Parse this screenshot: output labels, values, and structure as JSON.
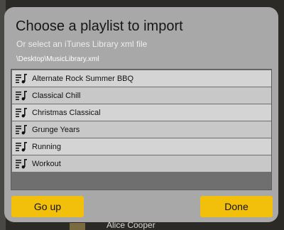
{
  "background": {
    "now_playing_artist": "Alice Cooper"
  },
  "dialog": {
    "title": "Choose a playlist to import",
    "subtitle": "Or select an iTunes Library xml file",
    "file_path": "\\Desktop\\MusicLibrary.xml",
    "playlists": [
      {
        "name": "Alternate Rock Summer BBQ",
        "icon": "playlist-icon"
      },
      {
        "name": "Classical Chill",
        "icon": "playlist-icon"
      },
      {
        "name": "Christmas Classical",
        "icon": "playlist-icon"
      },
      {
        "name": "Grunge Years",
        "icon": "playlist-icon"
      },
      {
        "name": "Running",
        "icon": "playlist-icon"
      },
      {
        "name": "Workout",
        "icon": "playlist-icon"
      }
    ],
    "buttons": {
      "back_label": "Go up",
      "done_label": "Done"
    },
    "colors": {
      "accent": "#f2c00a",
      "dialog_bg": "#a8a8a8",
      "row_bg": "#d4d4d4"
    }
  }
}
